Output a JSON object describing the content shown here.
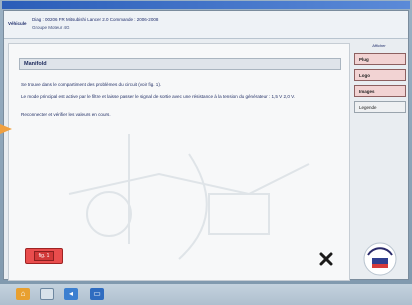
{
  "infobar": {
    "label": "Véhicule",
    "row1": "Diag : 00206   FR   Mitsubishi   Lancer 2.0   Commande : 2006-2008",
    "row2": "Groupe Moteur   4G"
  },
  "panel": {
    "title": "Manifold",
    "line1": "Se trouve dans le compartiment des problèmes du circuit (voir fig. 1).",
    "line2": "Le mode principal est active par le filtre et laisse passer le signal de sortie avec une résistance à la tension du générateur : 1,5 V 2,0 V.",
    "line3": "Reconnecter et vérifier les valeurs en cours.",
    "fig_label": "fig. 1"
  },
  "side": {
    "header": "Afficher",
    "buttons": [
      "Plug",
      "Logo",
      "Images",
      "Legende"
    ]
  },
  "colors": {
    "accent": "#e94d4d",
    "side_button": "#f2d3d3",
    "title_bar": "#2a5db8"
  },
  "icons": {
    "close": "close-x-icon",
    "logo": "brand-logo-icon",
    "taskbar": [
      "home-icon",
      "window-icon",
      "back-icon",
      "monitor-icon"
    ]
  }
}
